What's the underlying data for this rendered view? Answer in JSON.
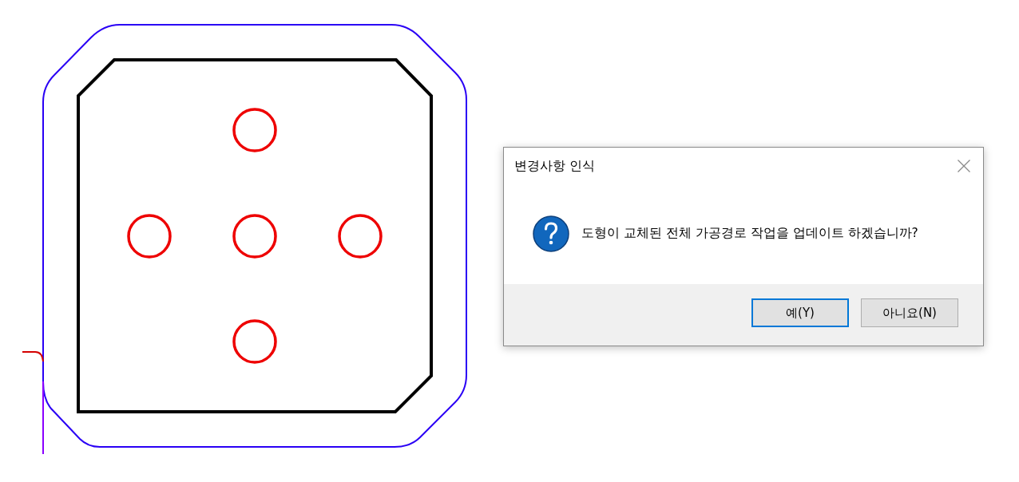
{
  "dialog": {
    "title": "변경사항 인식",
    "message": "도형이 교체된 전체 가공경로 작업을 업데이트 하겠습니까?",
    "buttons": [
      {
        "label": "예(Y)",
        "focused": true
      },
      {
        "label": "아니요(N)",
        "focused": false
      }
    ]
  }
}
